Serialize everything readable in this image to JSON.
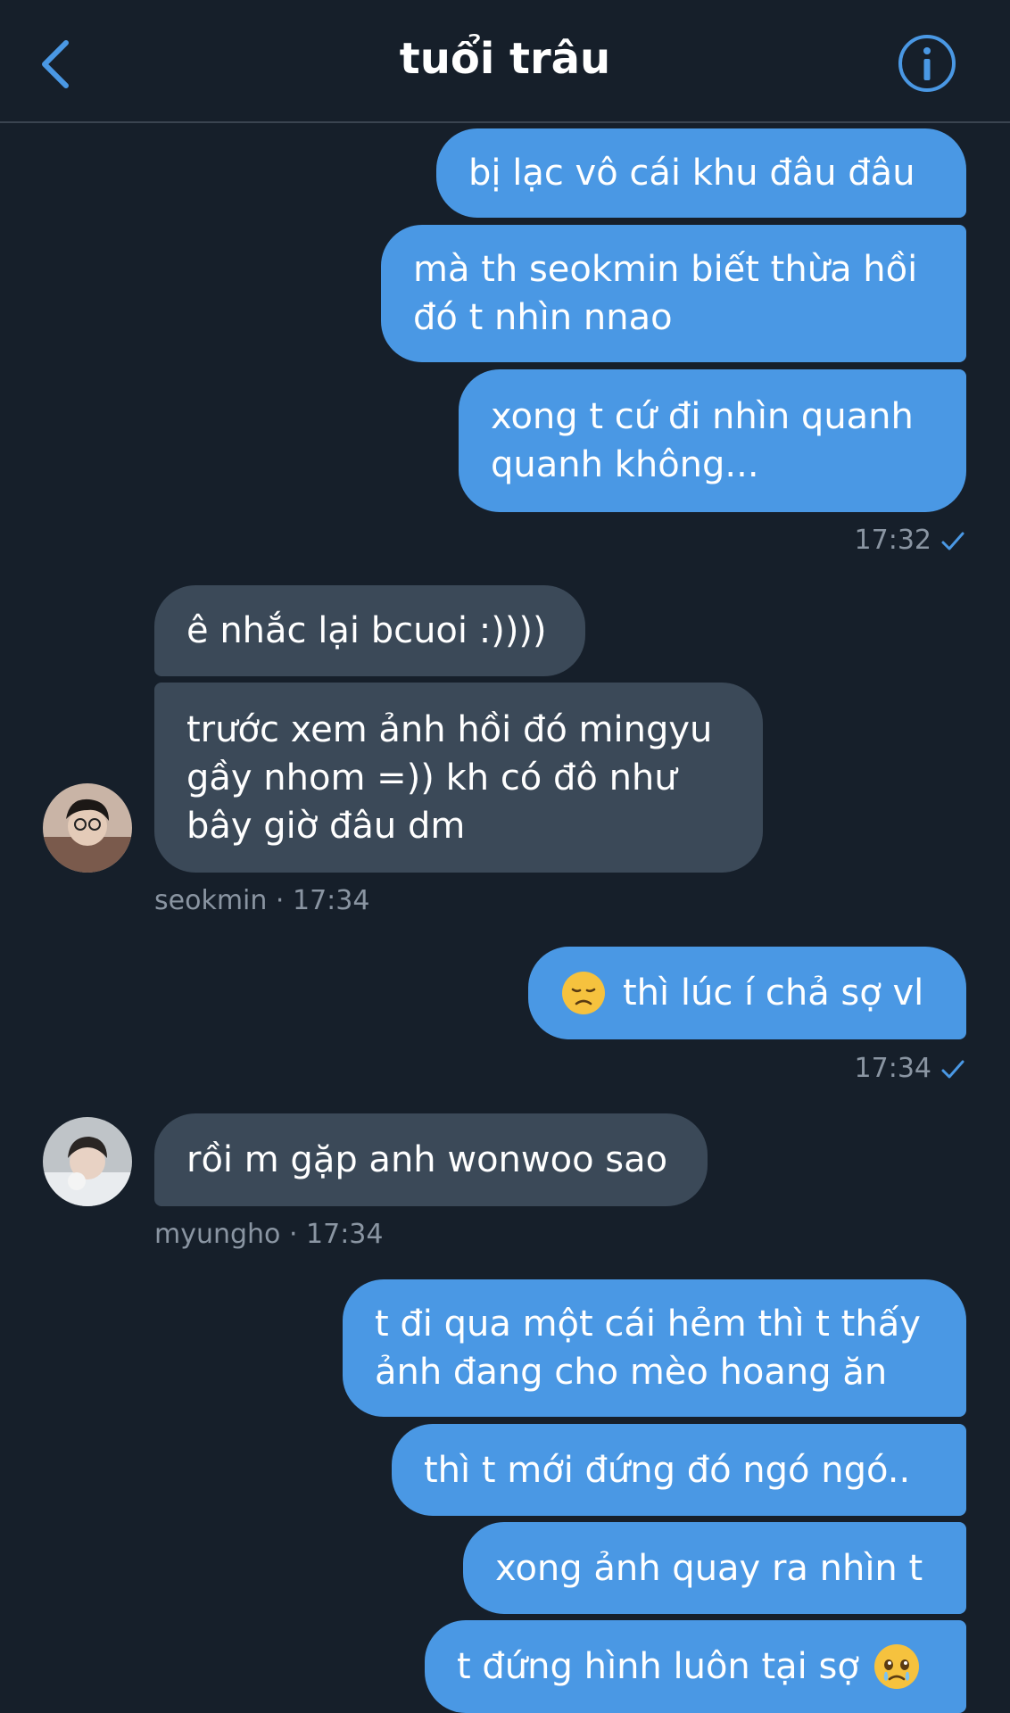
{
  "header": {
    "title": "tuổi trâu"
  },
  "messages": {
    "m1": "bị lạc vô cái khu đâu đâu",
    "m2": "mà th seokmin biết thừa hồi\nđó t nhìn nnao",
    "m3": "xong t cứ đi nhìn quanh\nquanh không...",
    "t1": "17:32",
    "m4": "ê nhắc lại bcuoi :))))",
    "m5": "trước xem ảnh hồi đó mingyu\ngầy nhom =)) kh có đô như\nbây giờ đâu dm",
    "s1": "seokmin · 17:34",
    "m6": "thì lúc í chả sợ vl",
    "t2": "17:34",
    "m7": "rồi m gặp anh wonwoo sao",
    "s2": "myungho · 17:34",
    "m8": "t đi qua một cái hẻm thì t thấy\nảnh đang cho mèo hoang ăn",
    "m9": "thì t mới đứng đó ngó ngó..",
    "m10": "xong ảnh quay ra nhìn t",
    "m11": "t đứng hình luôn tại sợ"
  },
  "colors": {
    "background": "#161f2a",
    "outgoing_bubble": "#4a98e4",
    "incoming_bubble": "#3b4958",
    "accent": "#4a98e4",
    "meta_text": "#8a95a2"
  },
  "icons": {
    "back": "chevron-left-icon",
    "info": "info-circle-icon",
    "read": "checkmark-icon",
    "emoji_sad": "disappointed-face-emoji",
    "emoji_cry": "holding-back-tears-emoji"
  }
}
